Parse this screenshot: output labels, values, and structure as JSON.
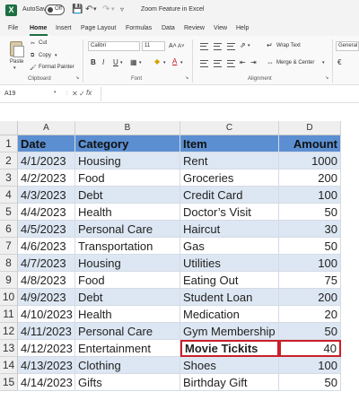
{
  "titlebar": {
    "app_icon": "X",
    "autosave_label": "AutoSave",
    "autosave_state": "Off",
    "doc_title": "Zoom Feature in Excel",
    "icons": [
      "save-icon",
      "undo-icon",
      "redo-icon",
      "customize-icon"
    ]
  },
  "menu": {
    "tabs": [
      "File",
      "Home",
      "Insert",
      "Page Layout",
      "Formulas",
      "Data",
      "Review",
      "View",
      "Help"
    ],
    "active": "Home"
  },
  "ribbon": {
    "clipboard": {
      "paste": "Paste",
      "cut": "Cut",
      "copy": "Copy",
      "format_painter": "Format Painter",
      "group_label": "Clipboard"
    },
    "font": {
      "font_name": "Calibri",
      "font_size": "11",
      "group_label": "Font",
      "bold": "B",
      "italic": "I",
      "underline": "U",
      "font_color_letter": "A"
    },
    "alignment": {
      "wrap_text": "Wrap Text",
      "merge_center": "Merge & Center",
      "group_label": "Alignment"
    },
    "number": {
      "format": "General"
    }
  },
  "formula_bar": {
    "name_box": "A19",
    "fx": "fx",
    "formula": ""
  },
  "sheet": {
    "columns": [
      "A",
      "B",
      "C",
      "D"
    ],
    "row_numbers": [
      "1",
      "2",
      "3",
      "4",
      "5",
      "6",
      "7",
      "8",
      "9",
      "10",
      "11",
      "12",
      "13",
      "14",
      "15"
    ],
    "headers": [
      "Date",
      "Category",
      "Item",
      "Amount"
    ],
    "rows": [
      [
        "4/1/2023",
        "Housing",
        "Rent",
        "1000"
      ],
      [
        "4/2/2023",
        "Food",
        "Groceries",
        "200"
      ],
      [
        "4/3/2023",
        "Debt",
        "Credit Card",
        "100"
      ],
      [
        "4/4/2023",
        "Health",
        "Doctor’s Visit",
        "50"
      ],
      [
        "4/5/2023",
        "Personal Care",
        "Haircut",
        "30"
      ],
      [
        "4/6/2023",
        "Transportation",
        "Gas",
        "50"
      ],
      [
        "4/7/2023",
        "Housing",
        "Utilities",
        "100"
      ],
      [
        "4/8/2023",
        "Food",
        "Eating Out",
        "75"
      ],
      [
        "4/9/2023",
        "Debt",
        "Student Loan",
        "200"
      ],
      [
        "4/10/2023",
        "Health",
        "Medication",
        "20"
      ],
      [
        "4/11/2023",
        "Personal Care",
        "Gym Membership",
        "50"
      ],
      [
        "4/12/2023",
        "Entertainment",
        "Movie Tickits",
        "40"
      ],
      [
        "4/13/2023",
        "Clothing",
        "Shoes",
        "100"
      ],
      [
        "4/14/2023",
        "Gifts",
        "Birthday Gift",
        "50"
      ]
    ],
    "header_color": "#5b8fd1",
    "band_color": "#dde7f3",
    "highlight_color": "#c8202b"
  }
}
